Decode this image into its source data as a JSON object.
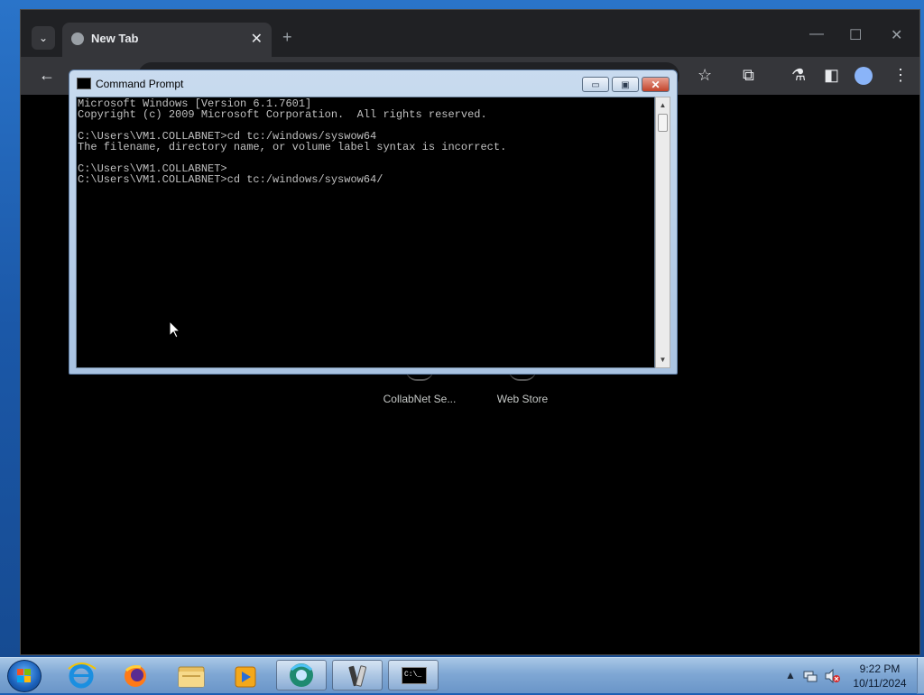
{
  "browser": {
    "tab_title": "New Tab",
    "tab_close": "✕",
    "new_tab": "+",
    "minimize": "—",
    "maximize": "☐",
    "close": "✕",
    "back": "←",
    "bookmark_icon": "☆",
    "extensions_icon": "⧉",
    "labs_icon": "⚗",
    "sidepanel_icon": "◧",
    "menu_icon": "⋮"
  },
  "shortcuts": [
    {
      "label": "CollabNet Se..."
    },
    {
      "label": "Web Store"
    }
  ],
  "cmd": {
    "title": "Command Prompt",
    "min_label": "▭",
    "max_label": "▣",
    "close_label": "✕",
    "lines": "Microsoft Windows [Version 6.1.7601]\nCopyright (c) 2009 Microsoft Corporation.  All rights reserved.\n\nC:\\Users\\VM1.COLLABNET>cd tc:/windows/syswow64\nThe filename, directory name, or volume label syntax is incorrect.\n\nC:\\Users\\VM1.COLLABNET>\nC:\\Users\\VM1.COLLABNET>cd tc:/windows/syswow64/",
    "scroll_up": "▲",
    "scroll_down": "▼"
  },
  "taskbar": {
    "items": [
      {
        "name": "internet-explorer"
      },
      {
        "name": "firefox"
      },
      {
        "name": "file-explorer"
      },
      {
        "name": "media-player"
      },
      {
        "name": "chrome"
      },
      {
        "name": "tools"
      },
      {
        "name": "command-prompt"
      }
    ],
    "cmd_icon_text": "C:\\_",
    "tray_arrow": "▲",
    "clock_time": "9:22 PM",
    "clock_date": "10/11/2024"
  },
  "colors": {
    "browser_bg": "#202124",
    "page_bg": "#000000",
    "console_text": "#c0c0c0"
  }
}
